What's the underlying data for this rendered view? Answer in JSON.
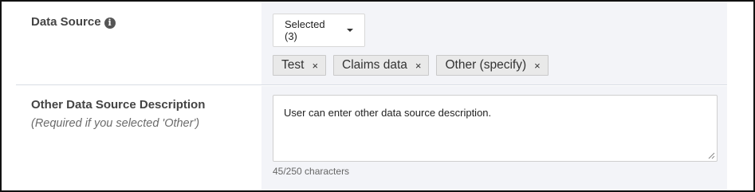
{
  "data_source": {
    "label": "Data Source",
    "info_icon_glyph": "i",
    "select_label": "Selected (3)",
    "tags": [
      {
        "label": "Test",
        "remove": "×"
      },
      {
        "label": "Claims data",
        "remove": "×"
      },
      {
        "label": "Other (specify)",
        "remove": "×"
      }
    ]
  },
  "other_description": {
    "label": "Other Data Source Description",
    "help": "(Required if you selected 'Other')",
    "value": "User can enter other data source description.",
    "char_count": "45/250 characters"
  },
  "icons": {
    "info": "info-circle-icon",
    "caret": "caret-down-icon",
    "remove": "close-icon",
    "resize": "resize-handle-icon"
  }
}
